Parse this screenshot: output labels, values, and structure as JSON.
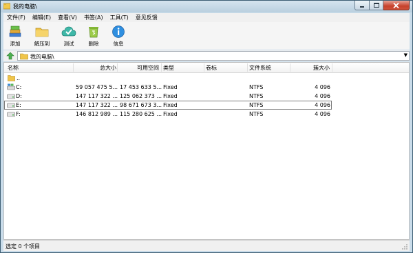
{
  "window": {
    "title": "我的电脑\\"
  },
  "menu": [
    "文件(F)",
    "编辑(E)",
    "查看(V)",
    "书签(A)",
    "工具(T)",
    "意见反馈"
  ],
  "toolbar": [
    {
      "label": "添加",
      "icon": "add-books-icon"
    },
    {
      "label": "解压到",
      "icon": "folder-icon"
    },
    {
      "label": "测试",
      "icon": "cloud-check-icon"
    },
    {
      "label": "删除",
      "icon": "recycle-bin-icon"
    },
    {
      "label": "信息",
      "icon": "info-icon"
    }
  ],
  "address": {
    "path": "我的电脑\\"
  },
  "columns": [
    "名称",
    "总大小",
    "可用空间",
    "类型",
    "卷标",
    "文件系统",
    "簇大小"
  ],
  "rows": [
    {
      "name": "..",
      "total": "",
      "free": "",
      "type": "",
      "label": "",
      "fs": "",
      "cluster": ""
    },
    {
      "name": "C:",
      "total": "59 057 475 5...",
      "free": "17 453 633 5...",
      "type": "Fixed",
      "label": "",
      "fs": "NTFS",
      "cluster": "4 096"
    },
    {
      "name": "D:",
      "total": "147 117 322 ...",
      "free": "125 062 373 ...",
      "type": "Fixed",
      "label": "",
      "fs": "NTFS",
      "cluster": "4 096"
    },
    {
      "name": "E:",
      "total": "147 117 322 ...",
      "free": "98 671 673 3...",
      "type": "Fixed",
      "label": "",
      "fs": "NTFS",
      "cluster": "4 096"
    },
    {
      "name": "F:",
      "total": "146 812 989 ...",
      "free": "115 280 625 ...",
      "type": "Fixed",
      "label": "",
      "fs": "NTFS",
      "cluster": "4 096"
    }
  ],
  "status": {
    "text": "选定 0 个项目"
  },
  "colors": {
    "window_frame": "#c9dcea",
    "close_button": "#c6412c"
  }
}
